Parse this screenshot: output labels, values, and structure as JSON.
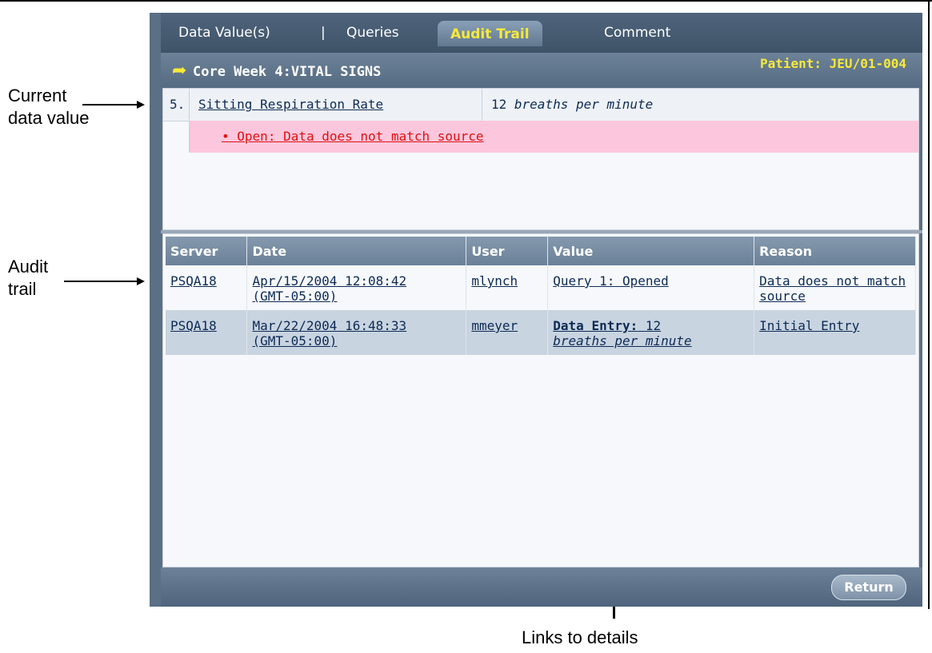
{
  "tabs": [
    {
      "label": "Data Value(s)"
    },
    {
      "label": "Queries"
    },
    {
      "label": "Audit Trail"
    },
    {
      "label": "Comment"
    }
  ],
  "tab_separator": "|",
  "header": {
    "title": "Core Week 4:VITAL SIGNS",
    "patient": "Patient: JEU/01-004"
  },
  "current": {
    "number": "5.",
    "label": "Sitting Respiration Rate",
    "value": "12",
    "unit": "breaths per minute",
    "query": "Open: Data does not match source"
  },
  "audit": {
    "columns": [
      "Server",
      "Date",
      "User",
      "Value",
      "Reason"
    ],
    "rows": [
      {
        "server": "PSQA18",
        "date": "Apr/15/2004 12:08:42",
        "tz": "(GMT-05:00)",
        "user": "mlynch",
        "value_prefix": "",
        "value": "Query 1: Opened",
        "value_unit": "",
        "reason": "Data does not match source"
      },
      {
        "server": "PSQA18",
        "date": "Mar/22/2004 16:48:33",
        "tz": "(GMT-05:00)",
        "user": "mmeyer",
        "value_prefix": "Data Entry:",
        "value": "12",
        "value_unit": "breaths per minute",
        "reason": "Initial Entry"
      }
    ]
  },
  "footer": {
    "return_label": "Return"
  },
  "annotations": {
    "current_line1": "Current",
    "current_line2": "data value",
    "audit_line1": "Audit",
    "audit_line2": "trail",
    "links": "Links to details"
  },
  "colors": {
    "accent": "#f7e93a",
    "query_bg": "#fcc7dd",
    "query_text": "#e01010",
    "window": "#5b6f85"
  }
}
